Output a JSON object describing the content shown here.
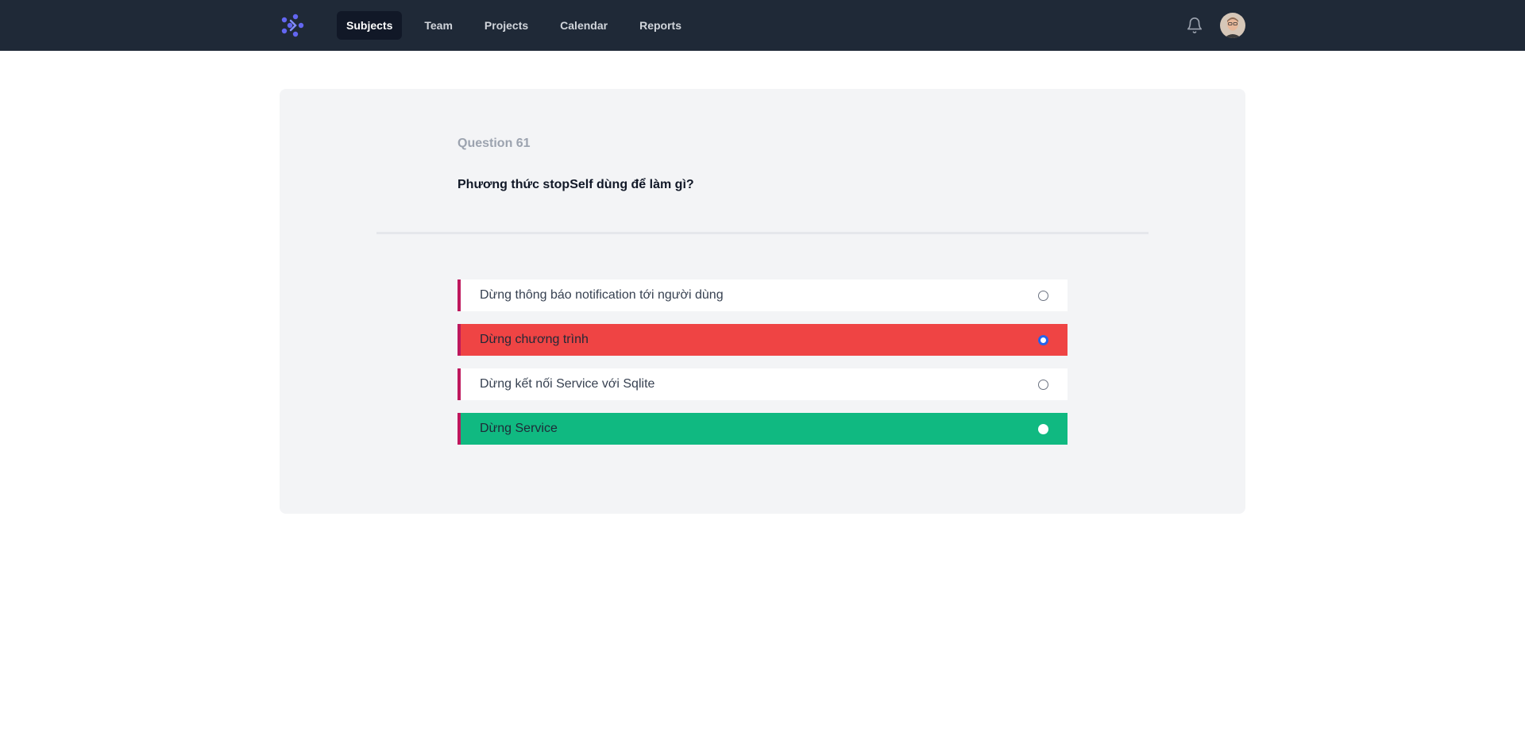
{
  "nav": {
    "links": [
      "Subjects",
      "Team",
      "Projects",
      "Calendar",
      "Reports"
    ],
    "active": "Subjects",
    "logo_icon": "logo-icon",
    "bell_icon": "bell-icon",
    "avatar_icon": "user-avatar"
  },
  "question": {
    "number_label": "Question 61",
    "text": "Phương thức stopSelf dùng để làm gì?"
  },
  "answers": [
    {
      "label": "Dừng thông báo notification tới người dùng",
      "state": "unselected"
    },
    {
      "label": "Dừng chương trình",
      "state": "selected-wrong"
    },
    {
      "label": "Dừng kết nối Service với Sqlite",
      "state": "unselected"
    },
    {
      "label": "Dừng Service",
      "state": "correct"
    }
  ],
  "colors": {
    "topbar": "#1f2937",
    "accent": "#6366f1",
    "wrong": "#ef4444",
    "correct": "#10b981",
    "answer_border": "#be185d"
  }
}
